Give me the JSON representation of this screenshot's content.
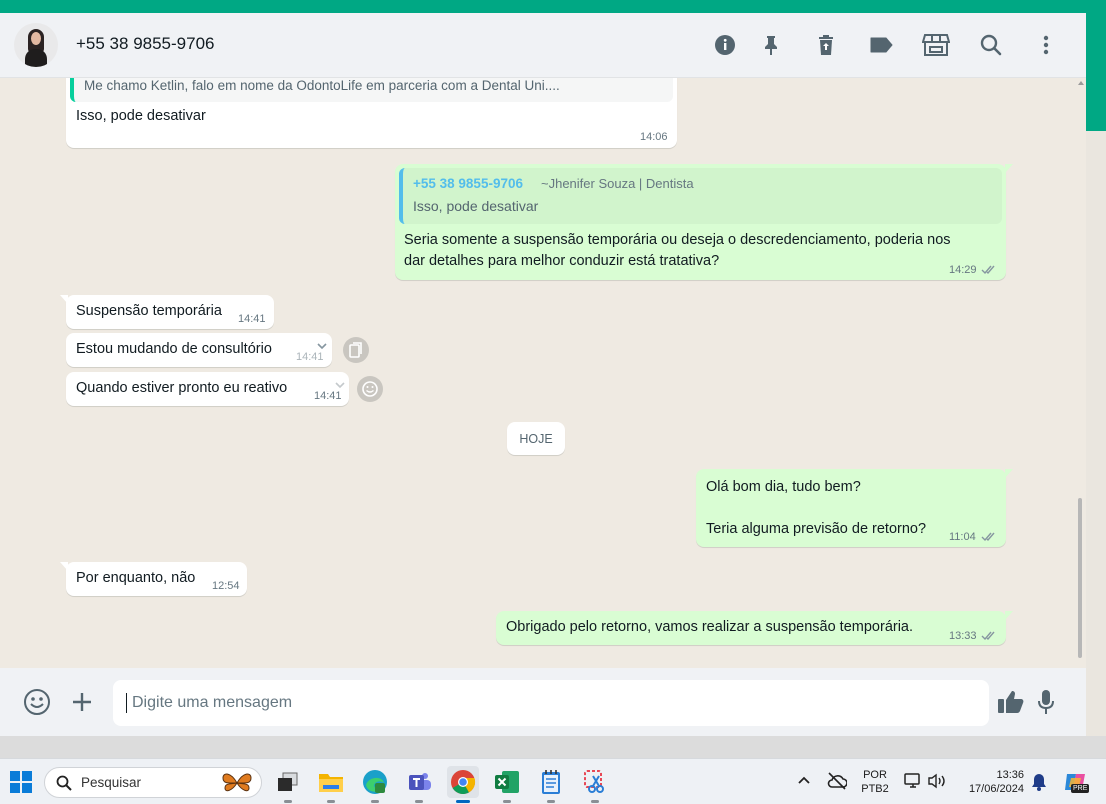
{
  "header": {
    "contact_name": "+55 38 9855-9706"
  },
  "messages": {
    "m1": {
      "quote_text": "Me chamo Ketlin, falo em nome da OdontoLife em parceria com a Dental Uni....",
      "text": "Isso, pode desativar",
      "time": "14:06"
    },
    "m2": {
      "quote_author": "+55 38 9855-9706",
      "quote_author_name": "~Jhenifer Souza | Dentista",
      "quote_text": "Isso, pode desativar",
      "line1": "Seria somente a suspensão temporária ou deseja o descredenciamento, poderia nos",
      "line2": "dar detalhes para melhor conduzir está tratativa?",
      "time": "14:29"
    },
    "m3": {
      "text": "Suspensão temporária",
      "time": "14:41"
    },
    "m4": {
      "text": "Estou mudando de consultório",
      "time": "14:41"
    },
    "m5": {
      "text": "Quando estiver pronto eu reativo",
      "time": "14:41"
    },
    "date_chip": "HOJE",
    "m6": {
      "line1": "Olá bom dia, tudo bem?",
      "line2": "Teria alguma previsão de retorno?",
      "time": "11:04"
    },
    "m7": {
      "text": "Por enquanto, não",
      "time": "12:54"
    },
    "m8": {
      "text": "Obrigado pelo retorno, vamos realizar a suspensão temporária.",
      "time": "13:33"
    }
  },
  "composer": {
    "placeholder": "Digite uma mensagem"
  },
  "taskbar": {
    "search_label": "Pesquisar",
    "lang_top": "POR",
    "lang_bottom": "PTB2",
    "clock_time": "13:36",
    "clock_date": "17/06/2024",
    "copilot_badge": "PRE"
  },
  "icons": {
    "header": [
      "info-icon",
      "pin-icon",
      "trash-icon",
      "label-icon",
      "store-icon",
      "search-icon",
      "menu-icon"
    ],
    "composer": [
      "emoji-icon",
      "plus-icon",
      "thumbs-up-icon",
      "mic-icon"
    ]
  },
  "colors": {
    "accent": "#00a884",
    "incoming_bubble": "#ffffff",
    "outgoing_bubble": "#d9fdd3",
    "chat_background": "#efeae2",
    "read_ticks": "#8696a0"
  }
}
